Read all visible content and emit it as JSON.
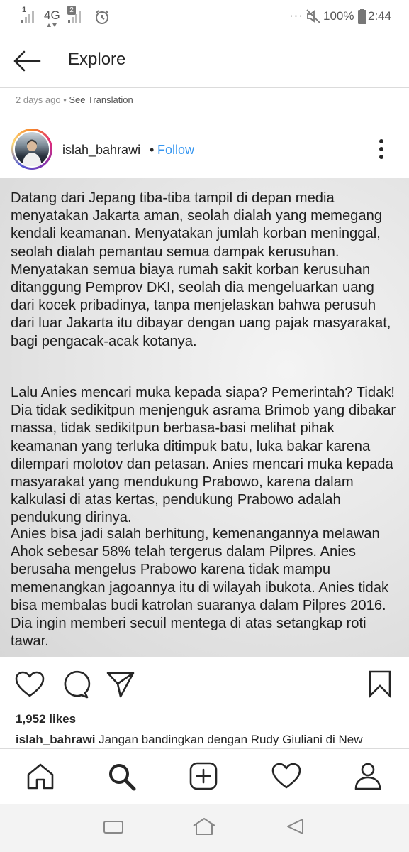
{
  "status_bar": {
    "signal_1_label": "1",
    "network_type": "4G",
    "signal_2_label": "2",
    "battery_percent": "100%",
    "time": "2:44",
    "more_dots": "···"
  },
  "app_bar": {
    "title": "Explore"
  },
  "post_meta": {
    "age": "2 days ago",
    "separator": " • ",
    "see_translation": "See Translation"
  },
  "post": {
    "username": "islah_bahrawi",
    "dot": "•",
    "follow_label": "Follow",
    "image_text": {
      "paragraph_1": "Datang dari Jepang tiba-tiba tampil di depan media menyatakan Jakarta aman, seolah dialah yang memegang kendali keamanan. Menyatakan jumlah korban meninggal, seolah dialah pemantau semua dampak kerusuhan. Menyatakan semua biaya rumah sakit korban kerusuhan ditanggung Pemprov DKI, seolah dia mengeluarkan uang dari kocek pribadinya, tanpa menjelaskan bahwa perusuh dari luar Jakarta itu dibayar dengan uang pajak masyarakat, bagi pengacak-acak kotanya.",
      "paragraph_2": "Lalu Anies mencari muka kepada siapa? Pemerintah? Tidak! Dia tidak sedikitpun menjenguk asrama Brimob yang dibakar massa, tidak sedikitpun berbasa-basi melihat pihak keamanan yang terluka ditimpuk batu, luka bakar karena dilempari molotov dan petasan. Anies mencari muka kepada masyarakat yang mendukung Prabowo, karena dalam kalkulasi di atas kertas, pendukung Prabowo adalah pendukung dirinya.",
      "paragraph_3": "Anies bisa jadi salah berhitung, kemenangannya melawan Ahok sebesar 58% telah tergerus dalam Pilpres. Anies berusaha mengelus Prabowo karena tidak mampu memenangkan jagoannya itu di wilayah ibukota. Anies tidak bisa membalas budi katrolan suaranya dalam Pilpres 2016. Dia ingin memberi secuil mentega di atas setangkap roti tawar."
    },
    "likes": "1,952 likes",
    "caption_username": "islah_bahrawi",
    "caption_text": " Jangan bandingkan dengan Rudy Giuliani di New"
  },
  "colors": {
    "link_blue": "#3897f0",
    "text_dark": "#262626",
    "muted": "#8e8e8e"
  },
  "icons": {
    "back": "arrow-left-icon",
    "more": "vertical-dots-icon",
    "like": "heart-icon",
    "comment": "comment-bubble-icon",
    "share": "paper-plane-icon",
    "save": "bookmark-icon",
    "home": "home-icon",
    "search": "search-icon",
    "add": "add-post-icon",
    "activity": "heart-icon",
    "profile": "profile-icon"
  }
}
